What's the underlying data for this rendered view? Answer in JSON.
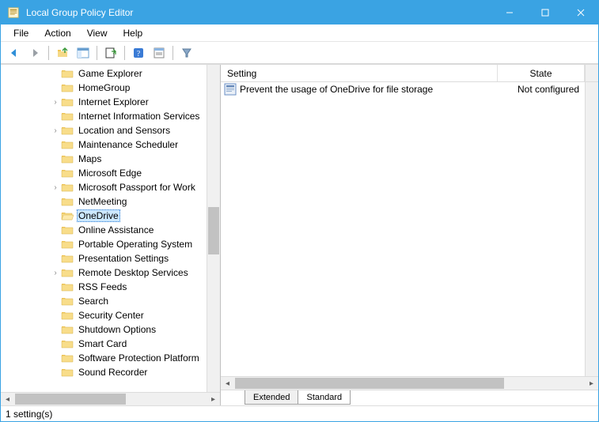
{
  "window": {
    "title": "Local Group Policy Editor"
  },
  "menu": {
    "file": "File",
    "action": "Action",
    "view": "View",
    "help": "Help"
  },
  "tree": {
    "items": [
      {
        "label": "Game Explorer",
        "expand": ""
      },
      {
        "label": "HomeGroup",
        "expand": ""
      },
      {
        "label": "Internet Explorer",
        "expand": ">"
      },
      {
        "label": "Internet Information Services",
        "expand": ""
      },
      {
        "label": "Location and Sensors",
        "expand": ">"
      },
      {
        "label": "Maintenance Scheduler",
        "expand": ""
      },
      {
        "label": "Maps",
        "expand": ""
      },
      {
        "label": "Microsoft Edge",
        "expand": ""
      },
      {
        "label": "Microsoft Passport for Work",
        "expand": ">"
      },
      {
        "label": "NetMeeting",
        "expand": ""
      },
      {
        "label": "OneDrive",
        "expand": "",
        "selected": true
      },
      {
        "label": "Online Assistance",
        "expand": ""
      },
      {
        "label": "Portable Operating System",
        "expand": ""
      },
      {
        "label": "Presentation Settings",
        "expand": ""
      },
      {
        "label": "Remote Desktop Services",
        "expand": ">"
      },
      {
        "label": "RSS Feeds",
        "expand": ""
      },
      {
        "label": "Search",
        "expand": ""
      },
      {
        "label": "Security Center",
        "expand": ""
      },
      {
        "label": "Shutdown Options",
        "expand": ""
      },
      {
        "label": "Smart Card",
        "expand": ""
      },
      {
        "label": "Software Protection Platform",
        "expand": ""
      },
      {
        "label": "Sound Recorder",
        "expand": ""
      }
    ]
  },
  "list": {
    "columns": {
      "setting": "Setting",
      "state": "State"
    },
    "items": [
      {
        "setting": "Prevent the usage of OneDrive for file storage",
        "state": "Not configured"
      }
    ]
  },
  "tabs": {
    "extended": "Extended",
    "standard": "Standard"
  },
  "status": {
    "text": "1 setting(s)"
  }
}
